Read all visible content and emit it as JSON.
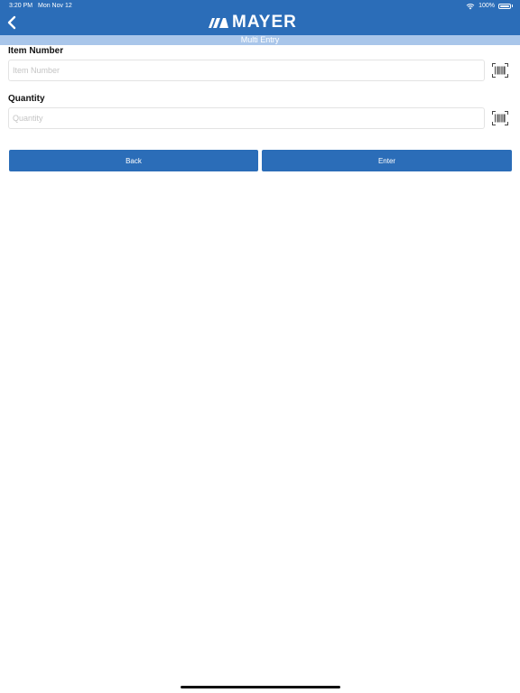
{
  "status_bar": {
    "time": "3:20 PM",
    "date": "Mon Nov 12",
    "battery": "100%"
  },
  "header": {
    "logo_text": "MAYER",
    "back_icon": "chevron-left-icon",
    "background_color": "#2b6db8"
  },
  "subtitle": "Multi Entry",
  "form": {
    "item_number": {
      "label": "Item Number",
      "placeholder": "Item Number",
      "value": "",
      "scan_icon": "barcode-scan-icon"
    },
    "quantity": {
      "label": "Quantity",
      "placeholder": "Quantity",
      "value": "",
      "scan_icon": "barcode-scan-icon"
    }
  },
  "actions": {
    "back_label": "Back",
    "enter_label": "Enter"
  }
}
